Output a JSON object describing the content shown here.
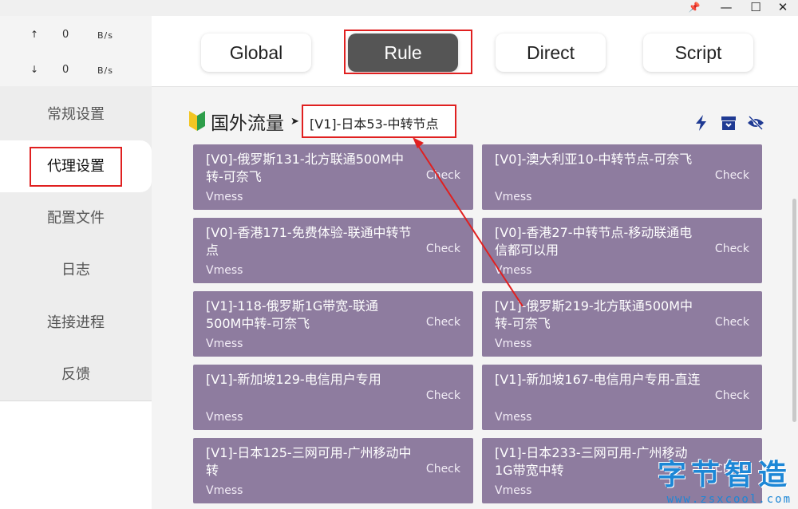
{
  "window": {
    "pin_glyph": "📌",
    "minimize_glyph": "—",
    "maximize_glyph": "☐",
    "close_glyph": "✕"
  },
  "traffic": {
    "up_arrow": "↑",
    "up_value": "0",
    "up_unit": "B/s",
    "down_arrow": "↓",
    "down_value": "0",
    "down_unit": "B/s"
  },
  "sidebar": {
    "items": [
      {
        "label": "常规设置"
      },
      {
        "label": "代理设置"
      },
      {
        "label": "配置文件"
      },
      {
        "label": "日志"
      },
      {
        "label": "连接进程"
      },
      {
        "label": "反馈"
      }
    ],
    "active_index": 1
  },
  "modes": {
    "items": [
      "Global",
      "Rule",
      "Direct",
      "Script"
    ],
    "active": "Rule"
  },
  "group": {
    "name": "国外流量",
    "arrow": "➤",
    "selected": "[V1]-日本53-中转节点",
    "icons": [
      "lightning-icon",
      "archive-icon",
      "eye-off-icon"
    ]
  },
  "proxies": [
    {
      "name": "[V0]-俄罗斯131-北方联通500M中转-可奈飞",
      "type": "Vmess",
      "check": "Check"
    },
    {
      "name": "[V0]-澳大利亚10-中转节点-可奈飞",
      "type": "Vmess",
      "check": "Check"
    },
    {
      "name": "[V0]-香港171-免费体验-联通中转节点",
      "type": "Vmess",
      "check": "Check"
    },
    {
      "name": "[V0]-香港27-中转节点-移动联通电信都可以用",
      "type": "Vmess",
      "check": "Check"
    },
    {
      "name": "[V1]-118-俄罗斯1G带宽-联通500M中转-可奈飞",
      "type": "Vmess",
      "check": "Check"
    },
    {
      "name": "[V1]-俄罗斯219-北方联通500M中转-可奈飞",
      "type": "Vmess",
      "check": "Check"
    },
    {
      "name": "[V1]-新加坡129-电信用户专用",
      "type": "Vmess",
      "check": "Check"
    },
    {
      "name": "[V1]-新加坡167-电信用户专用-直连",
      "type": "Vmess",
      "check": "Check"
    },
    {
      "name": "[V1]-日本125-三网可用-广州移动中转",
      "type": "Vmess",
      "check": "Check"
    },
    {
      "name": "[V1]-日本233-三网可用-广州移动1G带宽中转",
      "type": "Vmess",
      "check": "Check"
    }
  ],
  "colors": {
    "card": "#8e7c9f",
    "active_mode": "#555555",
    "annotation": "#e02020",
    "watermark": "#1d87d6",
    "icon": "#1f3a93"
  },
  "watermark": {
    "cn": "字节智造",
    "url": "www.zsxcool.com"
  }
}
